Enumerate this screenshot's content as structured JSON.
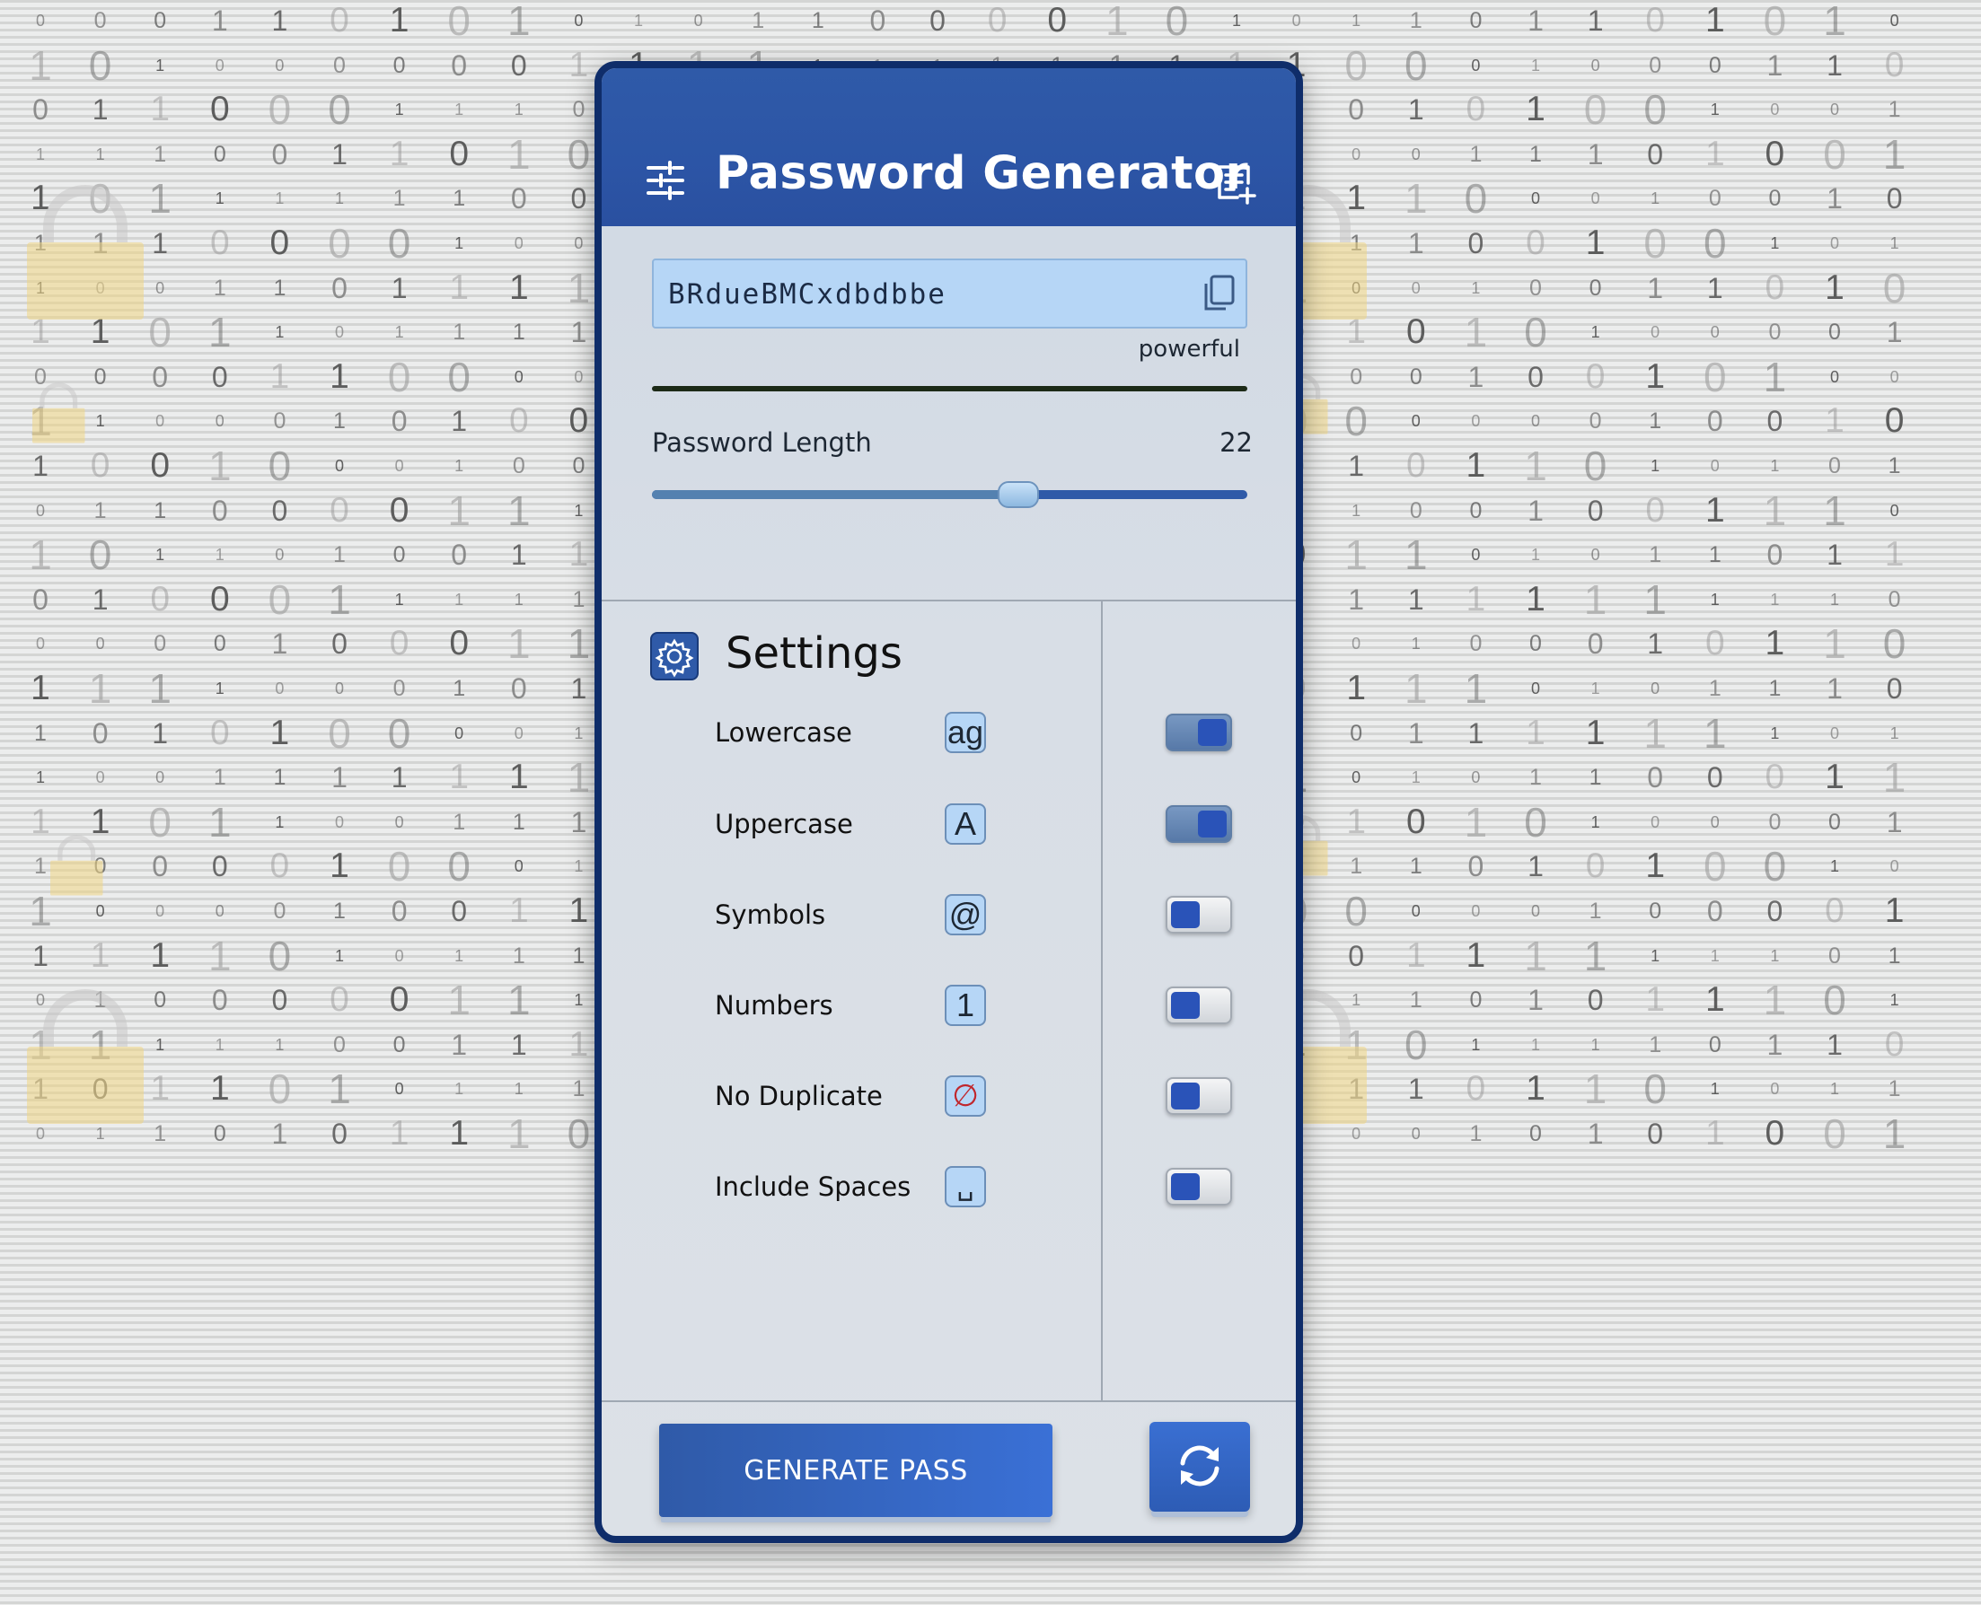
{
  "background": {
    "binary_rows": [
      "0 0 0 1 1 0 1 0 1 0 1 0 1 1 0 0 0 0 1 0 1 0 1 1 0 1 1 0 1 0 1 0",
      "1 0 1 0 0 0 0 0 0 1 1 1 1 1 1 1 1 1 1 1 1 1 0 0 0 1 0 0 0 1 1 0",
      "0 1 1 0 0 0 1 1 1 0 1 1 1 0 1 1 1 1 1 1 1 1 0 1 0 1 0 0 1 0 0 1",
      "1 1 1 0 0 1 1 0 1 0 0 1 1 0 1 1 1 1 1 1 1 1 0 0 1 1 1 0 1 0 0 1",
      "1 0 1 1 1 1 1 1 0 0 0 1 1 0 1 1 1 1 1 1 1 1 1 1 0 0 0 1 0 0 1 0",
      "1 1 1 0 0 0 0 1 0 0 0 0 0 1 1 0 0 0 1 1 1 1 1 1 0 0 1 0 0 1 0 1",
      "1 0 0 1 1 0 1 1 1 1 1 1 1 1 1 0 0 0 0 0 0 1 0 0 1 0 0 1 1 0 1 0",
      "1 1 0 1 1 0 1 1 1 1 1 1 1 0 0 1 1 0 0 1 0 0 1 0 1 0 1 0 0 0 0 1",
      "0 0 0 0 1 1 0 0 0 0 0 0 0 0 0 1 1 1 0 0 1 1 0 0 1 0 0 1 0 1 0 0",
      "1 1 0 0 0 1 0 1 0 0 1 1 1 1 1 0 1 1 0 0 1 0 0 0 0 0 0 1 0 0 1 0",
      "1 0 0 1 0 0 0 1 0 0 1 1 1 1 1 0 0 1 1 0 1 0 1 0 1 1 0 1 0 1 0 1",
      "0 1 1 0 0 0 0 1 1 1 1 1 1 1 1 1 1 1 1 1 1 0 1 0 0 1 0 0 1 1 1 0",
      "1 0 1 1 0 1 0 0 1 1 1 1 1 1 1 0 1 1 1 1 1 0 1 1 0 1 0 1 1 0 1 1",
      "0 1 0 0 0 1 1 1 1 1 1 1 1 1 1 1 1 0 1 1 1 0 1 1 1 1 1 1 1 1 1 0",
      "0 0 0 0 1 0 0 0 1 1 1 1 1 1 1 0 1 0 1 1 0 0 0 1 0 0 0 1 0 1 1 0",
      "1 1 1 1 0 0 0 1 0 1 1 1 1 1 1 1 1 0 1 1 0 0 1 1 1 0 1 0 1 1 1 0",
      "1 0 1 0 1 0 0 0 0 1 1 1 1 1 1 0 0 1 1 1 1 0 0 1 1 1 1 1 1 1 0 1",
      "1 0 0 1 1 1 1 1 1 1 1 1 1 1 1 1 1 0 0 1 1 1 0 1 0 1 1 0 0 0 1 1",
      "1 1 0 1 1 0 0 1 1 1 1 1 1 1 1 1 1 1 1 0 1 0 1 0 1 0 1 0 0 0 0 1",
      "1 0 0 0 0 1 0 0 0 1 1 1 1 1 1 1 1 1 0 0 1 0 1 1 0 1 0 1 0 0 1 0",
      "1 0 0 0 0 1 0 0 1 1 1 1 1 1 1 1 1 0 0 0 0 0 0 0 0 0 1 0 0 0 0 1",
      "1 1 1 1 0 1 0 1 1 1 1 1 1 1 1 1 1 0 1 0 1 0 0 1 1 1 1 1 1 1 0 1",
      "0 1 0 0 0 0 0 1 1 1 1 1 1 1 1 1 1 0 0 0 1 1 1 1 0 1 0 1 1 1 0 1",
      "1 1 1 1 1 0 0 1 1 1 1 1 1 1 1 1 1 0 0 1 0 1 1 0 1 1 1 1 0 1 1 0",
      "1 0 1 1 0 1 0 1 1 1 1 1 1 1 1 1 1 0 1 0 0 1 1 1 0 1 1 0 1 0 1 1",
      "0 1 1 0 1 0 1 1 1 0 0 1 0 0 0 1 1 1 1 1 1 0 0 0 1 0 1 0 1 0 0 1"
    ]
  },
  "header": {
    "title": "Password Generator",
    "left_icon": "tune-icon",
    "right_icon": "note-add-icon"
  },
  "password": {
    "value": "BRdueBMCxdbdbbe",
    "copy_icon": "copy-icon",
    "strength": "powerful",
    "strength_level": 1.0,
    "strength_color": "#1c2a17"
  },
  "length": {
    "label": "Password Length",
    "value": "22",
    "min": 6,
    "max": 32,
    "current": 22
  },
  "settings": {
    "title": "Settings",
    "icon": "settings-gear-icon",
    "items": [
      {
        "label": "Lowercase",
        "glyph": "ag",
        "enabled": true
      },
      {
        "label": "Uppercase",
        "glyph": "A",
        "enabled": true
      },
      {
        "label": "Symbols",
        "glyph": "@",
        "enabled": false
      },
      {
        "label": "Numbers",
        "glyph": "1",
        "enabled": false
      },
      {
        "label": "No Duplicate",
        "glyph": "∅",
        "enabled": false
      },
      {
        "label": "Include Spaces",
        "glyph": "␣",
        "enabled": false
      }
    ]
  },
  "actions": {
    "generate_label": "GENERATE PASS",
    "refresh_icon": "refresh-icon"
  },
  "colors": {
    "primary": "#2f5aa8",
    "frame": "#0f2d6a",
    "field_bg": "#b6d6f6",
    "toggle_knob": "#2a53b8"
  }
}
